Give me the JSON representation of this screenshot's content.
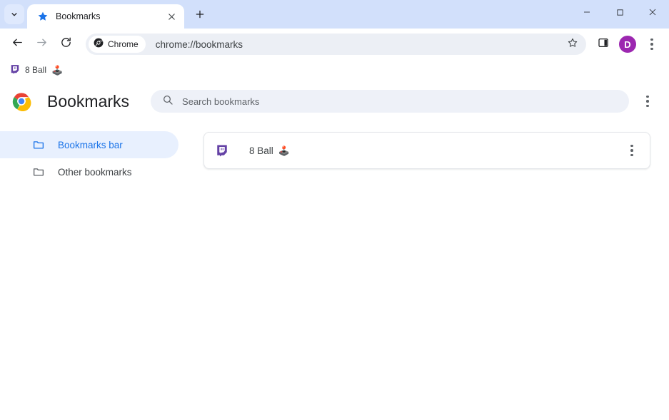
{
  "window": {
    "titlebar_color": "#d2e0fb",
    "controls": {
      "tab_search_icon": "chevron-down-icon",
      "minimize_label": "—",
      "maximize_label": "☐",
      "close_label": "✕"
    }
  },
  "tabstrip": {
    "tabs": [
      {
        "title": "Bookmarks",
        "favicon": "star-icon",
        "favicon_color": "#1a73e8",
        "active": true
      }
    ],
    "new_tab_label": "+",
    "close_label": "✕"
  },
  "toolbar": {
    "back_icon": "back-arrow-icon",
    "forward_icon": "forward-arrow-icon",
    "reload_icon": "reload-icon",
    "chip_label": "Chrome",
    "chip_icon": "chrome-logo-mono-icon",
    "url": "chrome://bookmarks",
    "bookmark_star_icon": "star-outline-icon",
    "side_panel_icon": "side-panel-icon",
    "profile_initial": "D",
    "profile_color": "#9c27b0",
    "menu_icon": "three-dot-menu-icon"
  },
  "bookmarks_bar": {
    "items": [
      {
        "label": "8 Ball",
        "emoji": "🕹️",
        "favicon": "twitch-icon",
        "favicon_color": "#6441a5"
      }
    ]
  },
  "page": {
    "logo_icon": "chrome-logo-icon",
    "title": "Bookmarks",
    "search": {
      "icon": "search-icon",
      "placeholder": "Search bookmarks",
      "value": ""
    },
    "more_menu_icon": "three-dot-menu-icon",
    "sidebar": {
      "items": [
        {
          "label": "Bookmarks bar",
          "icon": "folder-icon",
          "selected": true
        },
        {
          "label": "Other bookmarks",
          "icon": "folder-icon",
          "selected": false
        }
      ]
    },
    "bookmarks": [
      {
        "title": "8 Ball",
        "emoji": "🕹️",
        "favicon": "twitch-icon",
        "favicon_color": "#6441a5",
        "menu_icon": "three-dot-menu-icon"
      }
    ]
  },
  "colors": {
    "accent": "#1a73e8",
    "selected_bg": "#e8f0fe",
    "titlebar": "#d2e0fb",
    "omnibox": "#eceff5",
    "search_bg": "#eef1f8"
  }
}
